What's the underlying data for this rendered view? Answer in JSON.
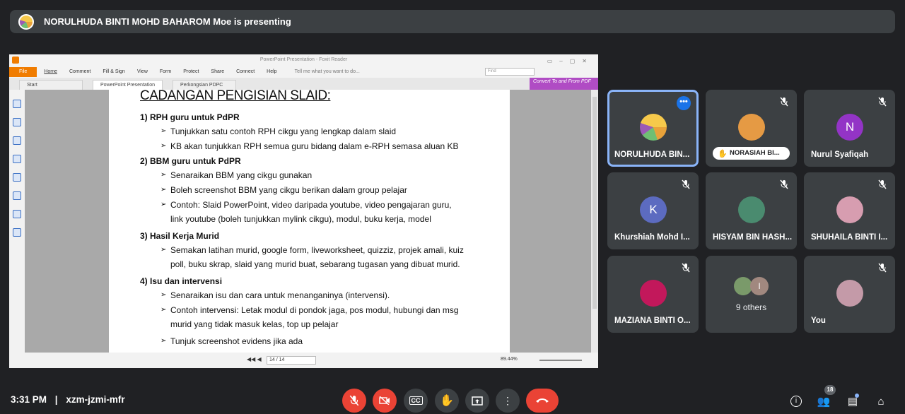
{
  "banner": {
    "text": "NORULHUDA BINTI MOHD BAHAROM Moe is presenting"
  },
  "app": {
    "title": "PowerPoint Presentation - Foxit Reader",
    "menu": [
      "File",
      "Home",
      "Comment",
      "Fill & Sign",
      "View",
      "Form",
      "Protect",
      "Share",
      "Connect",
      "Help"
    ],
    "tell_me": "Tell me what you want to do...",
    "find_placeholder": "Find",
    "tabs": [
      "Start",
      "PowerPoint Presentation",
      "Perkongsian PDPC"
    ],
    "convert": "Convert To and From PDF",
    "page_indicator": "14 / 14",
    "zoom": "89.44%"
  },
  "slide": {
    "title": "CADANGAN PENGISIAN SLAID:",
    "sections": [
      {
        "heading": "1) RPH guru untuk PdPR",
        "bullets": [
          "Tunjukkan satu contoh RPH cikgu yang lengkap dalam slaid",
          "KB akan tunjukkan RPH semua guru bidang dalam  e-RPH semasa aluan KB"
        ]
      },
      {
        "heading": "2) BBM guru untuk PdPR",
        "bullets": [
          "Senaraikan BBM yang cikgu gunakan",
          "Boleh screenshot BBM yang cikgu berikan dalam group pelajar",
          "Contoh: Slaid PowerPoint, video daripada youtube, video pengajaran guru, link youtube (boleh tunjukkan mylink cikgu), modul, buku kerja, model"
        ]
      },
      {
        "heading": "3) Hasil Kerja Murid",
        "bullets": [
          "Semakan latihan murid, google form, liveworksheet, quizziz, projek amali, kuiz poll, buku skrap, slaid yang murid buat, sebarang tugasan yang dibuat murid."
        ]
      },
      {
        "heading": "4) Isu dan intervensi",
        "bullets": [
          "Senaraikan isu dan cara untuk menanganinya (intervensi).",
          "Contoh intervensi: Letak modul di pondok jaga, pos modul, hubungi dan msg murid yang tidak masuk kelas, top up pelajar",
          "Tunjuk screenshot evidens jika ada"
        ]
      }
    ]
  },
  "participants": [
    {
      "name": "NORULHUDA BIN...",
      "initial": "",
      "color": "#f6c94b"
    },
    {
      "name": "NORASIAH BI...",
      "initial": "",
      "color": "#e59a44"
    },
    {
      "name": "Nurul Syafiqah",
      "initial": "N",
      "color": "#9334c6"
    },
    {
      "name": "Khurshiah Mohd I...",
      "initial": "K",
      "color": "#5c6bc0"
    },
    {
      "name": "HISYAM BIN HASH...",
      "initial": "",
      "color": "#4a8b6f"
    },
    {
      "name": "SHUHAILA BINTI I...",
      "initial": "",
      "color": "#d79db0"
    },
    {
      "name": "MAZIANA BINTI O...",
      "initial": "",
      "color": "#c2185b"
    },
    {
      "name": "9 others",
      "initial": "I",
      "color": "#a1887f"
    },
    {
      "name": "You",
      "initial": "",
      "color": "#c49aa8"
    }
  ],
  "footer": {
    "time": "3:31 PM",
    "separator": "|",
    "meeting_code": "xzm-jzmi-mfr",
    "participant_count": "18",
    "cc_label": "CC"
  },
  "colors": {
    "accent": "#8ab4f8",
    "end_call": "#ea4335",
    "tile": "#3c4043",
    "bg": "#202124"
  }
}
